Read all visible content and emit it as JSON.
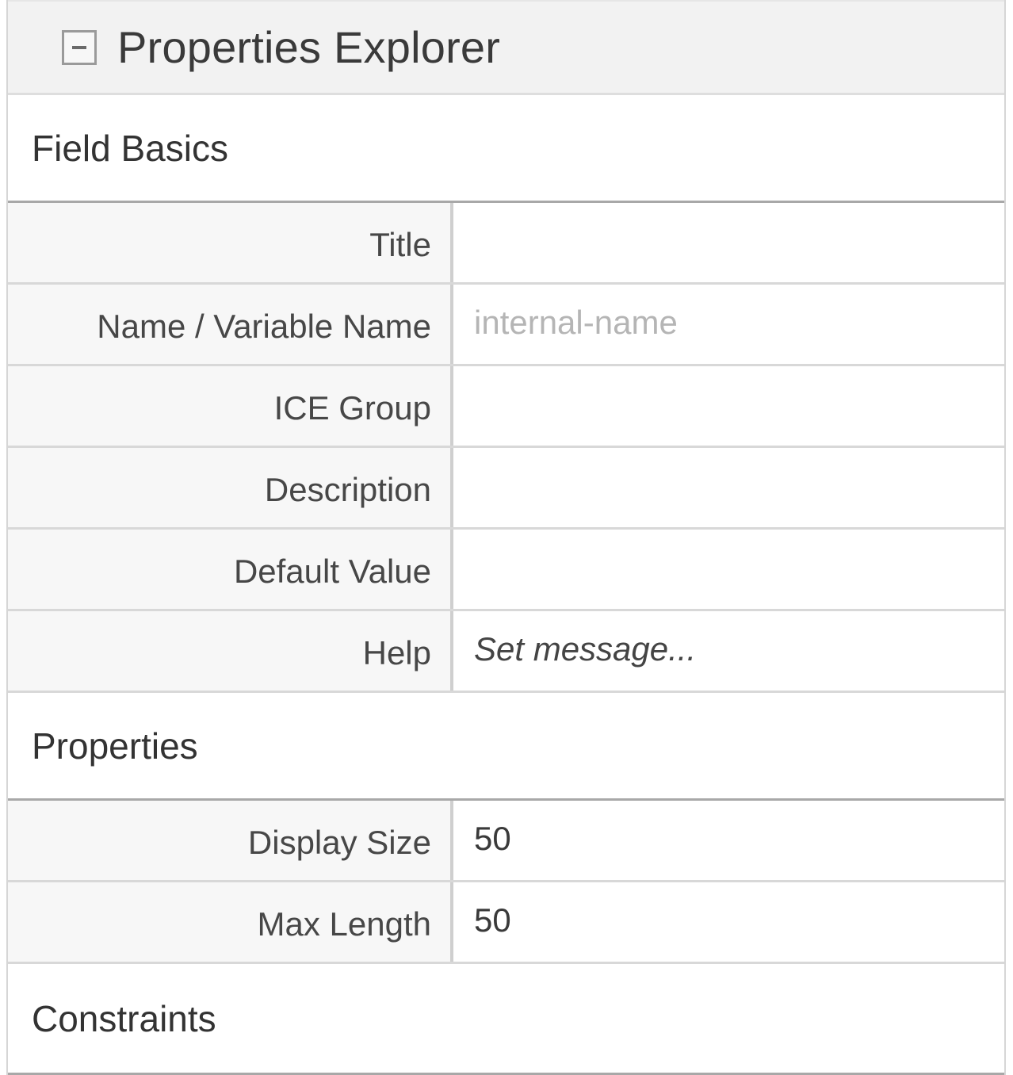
{
  "header": {
    "title": "Properties Explorer",
    "collapse_icon": "minus-square-icon"
  },
  "sections": {
    "field_basics": {
      "title": "Field Basics",
      "rows": [
        {
          "label": "Title",
          "value": "",
          "placeholder": ""
        },
        {
          "label": "Name / Variable Name",
          "value": "",
          "placeholder": "internal-name"
        },
        {
          "label": "ICE Group",
          "value": "",
          "placeholder": ""
        },
        {
          "label": "Description",
          "value": "",
          "placeholder": ""
        },
        {
          "label": "Default Value",
          "value": "",
          "placeholder": ""
        },
        {
          "label": "Help",
          "value": "Set message...",
          "placeholder": ""
        }
      ]
    },
    "properties": {
      "title": "Properties",
      "rows": [
        {
          "label": "Display Size",
          "value": "50"
        },
        {
          "label": "Max Length",
          "value": "50"
        }
      ]
    },
    "constraints": {
      "title": "Constraints"
    }
  }
}
